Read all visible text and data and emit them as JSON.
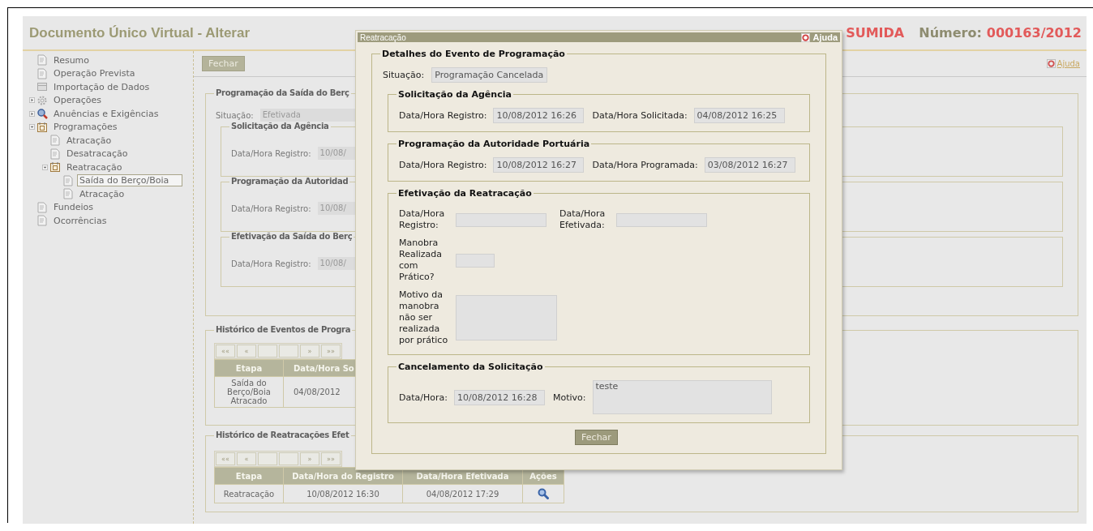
{
  "header": {
    "title": "Documento Único Virtual - Alterar",
    "status": "SUMIDA",
    "number_label": "Número:",
    "number": "000163/2012"
  },
  "sidebar": {
    "items": [
      {
        "label": "Resumo",
        "kind": "page",
        "selected": false
      },
      {
        "label": "Operação Prevista",
        "kind": "page",
        "selected": false
      },
      {
        "label": "Importação de Dados",
        "kind": "import",
        "selected": false
      },
      {
        "label": "Operações",
        "kind": "gear",
        "expanded": false,
        "selected": false
      },
      {
        "label": "Anuências e Exigências",
        "kind": "magnifier",
        "expanded": false,
        "selected": false
      },
      {
        "label": "Programações",
        "kind": "calendar",
        "expanded": true,
        "selected": false,
        "children": [
          {
            "label": "Atracação",
            "kind": "page",
            "selected": false
          },
          {
            "label": "Desatracação",
            "kind": "page",
            "selected": false
          },
          {
            "label": "Reatracação",
            "kind": "calendar",
            "expanded": true,
            "selected": false,
            "children": [
              {
                "label": "Saída do Berço/Boia",
                "kind": "page",
                "selected": true
              },
              {
                "label": "Atracação",
                "kind": "page",
                "selected": false
              }
            ]
          }
        ]
      },
      {
        "label": "Fundeios",
        "kind": "page",
        "selected": false
      },
      {
        "label": "Ocorrências",
        "kind": "page",
        "selected": false
      }
    ]
  },
  "toolbar": {
    "close_button": "Fechar",
    "help_link": "Ajuda"
  },
  "programacao": {
    "legend": "Programação da Saída do Berç",
    "situacao_label": "Situação:",
    "situacao_value": "Efetivada",
    "sections": [
      {
        "legend": "Solicitação da Agência",
        "label": "Data/Hora Registro:",
        "value": "10/08/"
      },
      {
        "legend": "Programação da Autoridad",
        "label": "Data/Hora Registro:",
        "value": "10/08/"
      },
      {
        "legend": "Efetivação da Saída do Berç",
        "label": "Data/Hora Registro:",
        "value": "10/08/"
      }
    ]
  },
  "historico_eventos": {
    "legend": "Histórico de Eventos de Progra",
    "pager": {
      "first": "««",
      "prev": "«",
      "next": "»",
      "last": "»»"
    },
    "columns": [
      "Etapa",
      "Data/Hora So"
    ],
    "rows": [
      {
        "cells": [
          "Saída do Berço/Boia Atracado",
          "04/08/2012"
        ]
      }
    ]
  },
  "historico_reatracacoes": {
    "legend": "Histórico de Reatracações Efet",
    "pager": {
      "first": "««",
      "prev": "«",
      "next": "»",
      "last": "»»"
    },
    "columns": [
      "Etapa",
      "Data/Hora do Registro",
      "Data/Hora Efetivada",
      "Ações"
    ],
    "rows": [
      {
        "cells": [
          "Reatracação",
          "10/08/2012 16:30",
          "04/08/2012 17:29"
        ]
      }
    ]
  },
  "modal": {
    "title": "Reatracação",
    "help": "Ajuda",
    "legend": "Detalhes do Evento de Programação",
    "situacao_label": "Situação:",
    "situacao_value": "Programação Cancelada",
    "sections": [
      {
        "legend": "Solicitação da Agência",
        "kind": "inline",
        "fields": [
          {
            "label": "Data/Hora Registro:",
            "value": "10/08/2012 16:26",
            "kind": "input"
          },
          {
            "label": "Data/Hora Solicitada:",
            "value": "04/08/2012 16:25",
            "kind": "input"
          }
        ]
      },
      {
        "legend": "Programação da Autoridade Portuária",
        "kind": "inline",
        "fields": [
          {
            "label": "Data/Hora Registro:",
            "value": "10/08/2012 16:27",
            "kind": "input"
          },
          {
            "label": "Data/Hora Programada:",
            "value": "03/08/2012 16:27",
            "kind": "input"
          }
        ]
      },
      {
        "legend": "Efetivação da Reatracação",
        "kind": "stacked",
        "fields": [
          {
            "label": "Data/Hora Registro:",
            "kind": "input"
          },
          {
            "label": "Data/Hora Efetivada:",
            "kind": "input"
          },
          {
            "label": "Manobra Realizada com Prático?",
            "kind": "short"
          },
          {
            "label": "Motivo da manobra não ser realizada por prático",
            "kind": "textarea"
          }
        ]
      },
      {
        "legend": "Cancelamento da Solicitação",
        "kind": "inline",
        "fields": [
          {
            "label": "Data/Hora:",
            "value": "10/08/2012 16:28",
            "kind": "input"
          },
          {
            "label": "Motivo:",
            "value": "teste",
            "kind": "textarea"
          }
        ]
      }
    ],
    "close_button": "Fechar"
  }
}
